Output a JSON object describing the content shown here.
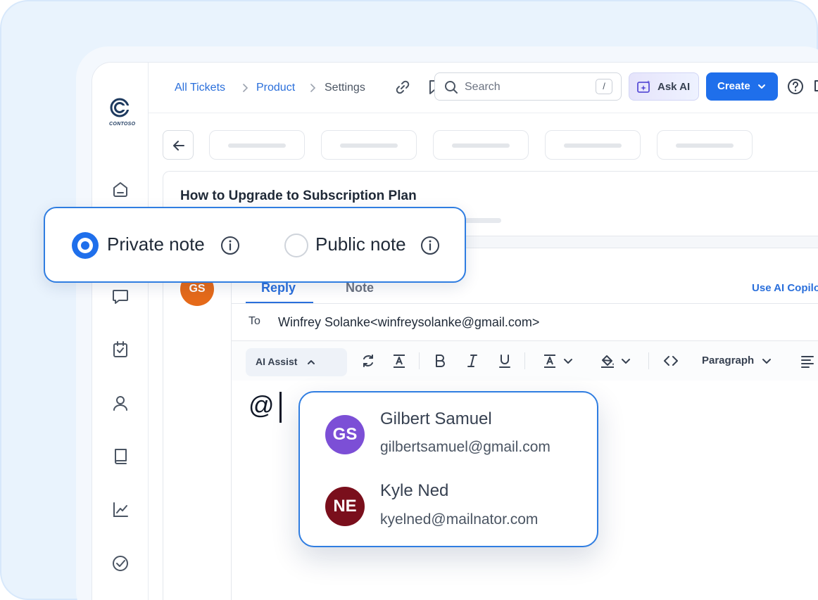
{
  "breadcrumb": {
    "items": [
      "All Tickets",
      "Product",
      "Settings"
    ]
  },
  "search": {
    "placeholder": "Search",
    "shortcut": "/"
  },
  "header": {
    "ask_ai_label": "Ask AI",
    "create_label": "Create"
  },
  "logo": {
    "text": "CONTOSO"
  },
  "ticket": {
    "title": "How to Upgrade to Subscription Plan"
  },
  "note_type": {
    "options": [
      {
        "label": "Private note",
        "selected": true
      },
      {
        "label": "Public note",
        "selected": false
      }
    ]
  },
  "conversation": {
    "avatar_initials": "GS",
    "avatar_color": "#e56a1a"
  },
  "editor": {
    "tabs": [
      "Reply",
      "Note"
    ],
    "active_tab": "Reply",
    "copilot_label": "Use AI Copilot",
    "to_label": "To",
    "to_value": "Winfrey Solanke<winfreysolanke@gmail.com>",
    "ai_assist_label": "AI Assist",
    "paragraph_label": "Paragraph",
    "content": "@"
  },
  "mention_suggestions": [
    {
      "initials": "GS",
      "name": "Gilbert Samuel",
      "email": "gilbertsamuel@gmail.com",
      "color": "#7c4fd6"
    },
    {
      "initials": "NE",
      "name": "Kyle Ned",
      "email": "kyelned@mailnator.com",
      "color": "#7a0f1c"
    }
  ],
  "colors": {
    "accent": "#1f6feb",
    "link": "#2a6fdb"
  }
}
